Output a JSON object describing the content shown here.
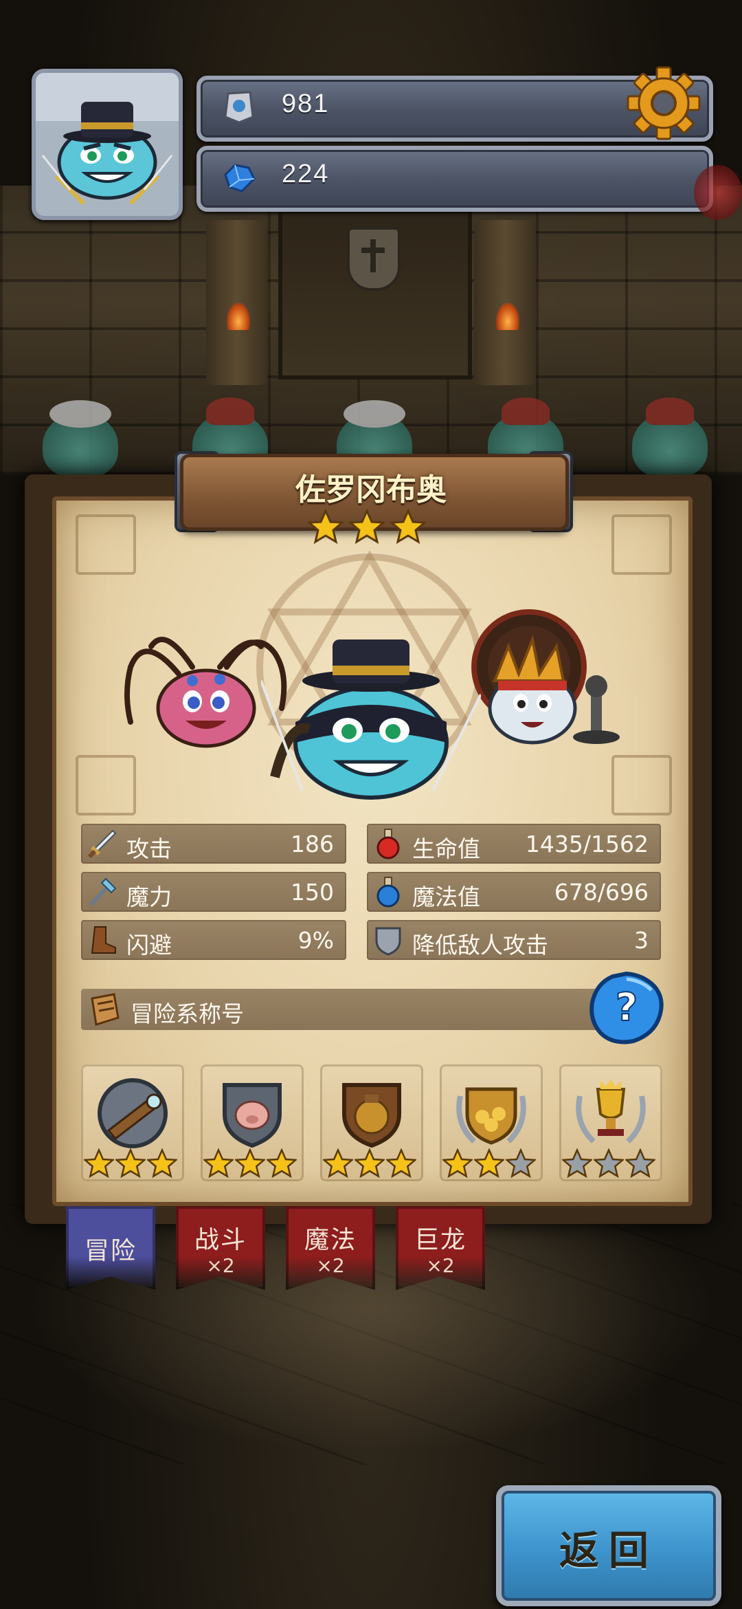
{
  "hud": {
    "resource1": {
      "icon": "rune-stone-icon",
      "value": "981"
    },
    "resource2": {
      "icon": "blue-gem-icon",
      "value": "224"
    },
    "settings_icon": "gear-icon"
  },
  "hero": {
    "name": "佐罗冈布奥",
    "stars": 3
  },
  "stats": {
    "attack": {
      "icon": "sword-icon",
      "label": "攻击",
      "value": "186"
    },
    "magic": {
      "icon": "staff-icon",
      "label": "魔力",
      "value": "150"
    },
    "dodge": {
      "icon": "boot-icon",
      "label": "闪避",
      "value": "9%"
    },
    "hp": {
      "icon": "red-potion-icon",
      "label": "生命值",
      "value": "1435/1562"
    },
    "mp": {
      "icon": "blue-potion-icon",
      "label": "魔法值",
      "value": "678/696"
    },
    "defense": {
      "icon": "shield-icon",
      "label": "降低敌人攻击",
      "value": "3"
    }
  },
  "title_row": {
    "icon": "scroll-icon",
    "label": "冒险系称号",
    "help_icon": "question-icon"
  },
  "achievements": [
    {
      "icon": "telescope-badge-icon",
      "stars": 3,
      "max": 3
    },
    {
      "icon": "pig-shield-badge-icon",
      "stars": 3,
      "max": 3
    },
    {
      "icon": "treasure-bag-badge-icon",
      "stars": 3,
      "max": 3
    },
    {
      "icon": "gold-pile-badge-icon",
      "stars": 2,
      "max": 3
    },
    {
      "icon": "trophy-badge-icon",
      "stars": 0,
      "max": 3
    }
  ],
  "tabs": [
    {
      "label": "冒险",
      "multiplier": "",
      "active": true
    },
    {
      "label": "战斗",
      "multiplier": "×2",
      "active": false
    },
    {
      "label": "魔法",
      "multiplier": "×2",
      "active": false
    },
    {
      "label": "巨龙",
      "multiplier": "×2",
      "active": false
    }
  ],
  "back_button": {
    "label": "返回"
  },
  "colors": {
    "star_gold": "#f5c21a",
    "star_grey": "#9aa0a8",
    "tab_active": "#4d4e9c",
    "tab_inactive": "#8e1d1d",
    "back_button": "#3d93cc"
  }
}
